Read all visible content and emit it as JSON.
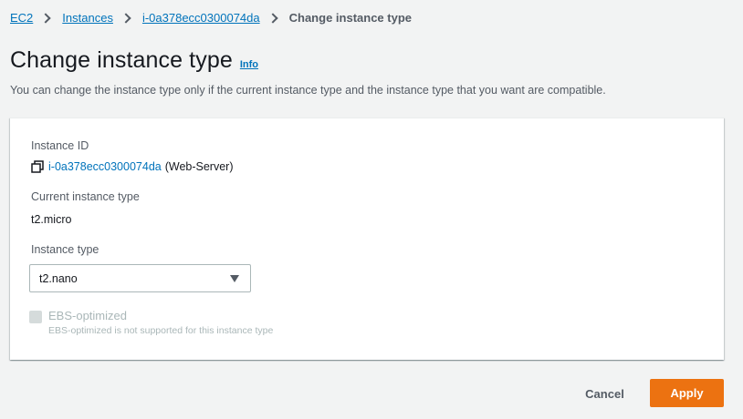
{
  "breadcrumb": {
    "items": [
      {
        "label": "EC2"
      },
      {
        "label": "Instances"
      },
      {
        "label": "i-0a378ecc0300074da"
      }
    ],
    "current": "Change instance type"
  },
  "header": {
    "title": "Change instance type",
    "info_label": "Info",
    "description": "You can change the instance type only if the current instance type and the instance type that you want are compatible."
  },
  "form": {
    "instance_id_label": "Instance ID",
    "instance_id_link": "i-0a378ecc0300074da",
    "instance_name": "(Web-Server)",
    "current_type_label": "Current instance type",
    "current_type_value": "t2.micro",
    "instance_type_label": "Instance type",
    "instance_type_selected": "t2.nano",
    "ebs_label": "EBS-optimized",
    "ebs_description": "EBS-optimized is not supported for this instance type",
    "ebs_checked": false,
    "ebs_disabled": true
  },
  "actions": {
    "cancel_label": "Cancel",
    "apply_label": "Apply"
  },
  "colors": {
    "link": "#0073bb",
    "primary_button": "#ec7211",
    "background": "#f2f3f3"
  },
  "icons": {
    "copy": "copy-icon",
    "breadcrumb_separator": "chevron-right-icon",
    "select_caret": "caret-down-icon"
  }
}
